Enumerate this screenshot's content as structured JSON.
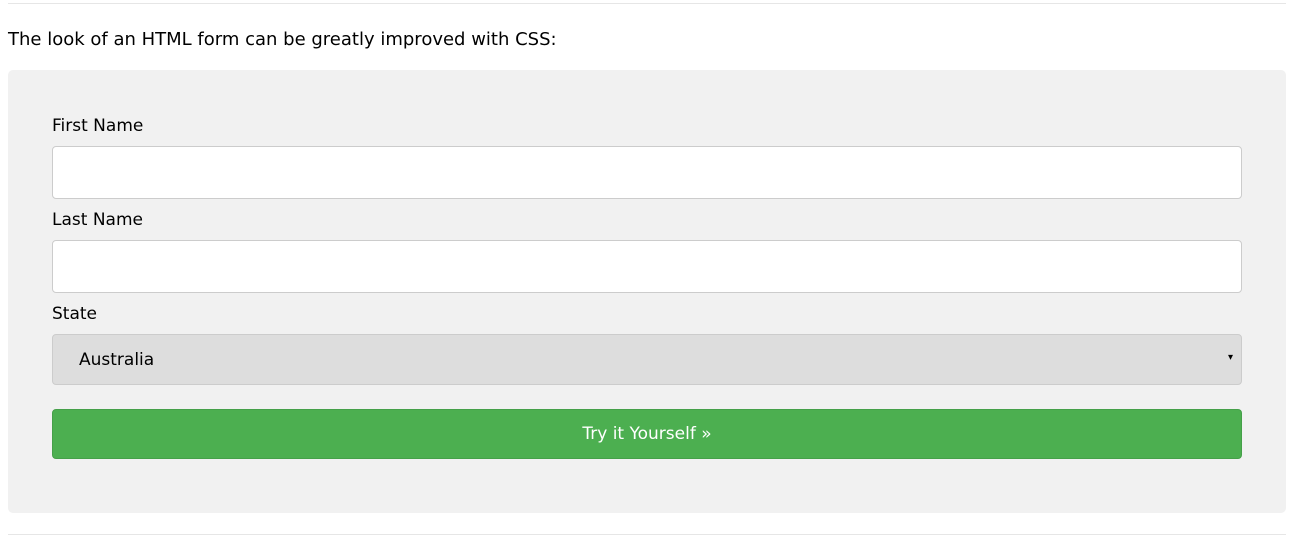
{
  "intro": {
    "text": "The look of an HTML form can be greatly improved with CSS:"
  },
  "form": {
    "first_name": {
      "label": "First Name",
      "value": "",
      "placeholder": ""
    },
    "last_name": {
      "label": "Last Name",
      "value": "",
      "placeholder": ""
    },
    "state": {
      "label": "State",
      "selected": "Australia",
      "arrow": "▾"
    },
    "submit": {
      "label": "Try it Yourself »"
    }
  },
  "colors": {
    "panel_background": "#f1f1f1",
    "input_background": "#ffffff",
    "input_border": "#cccccc",
    "select_background": "#dddddd",
    "button_background": "#4caf50",
    "button_text": "#ffffff",
    "divider": "#e6e6e6"
  }
}
